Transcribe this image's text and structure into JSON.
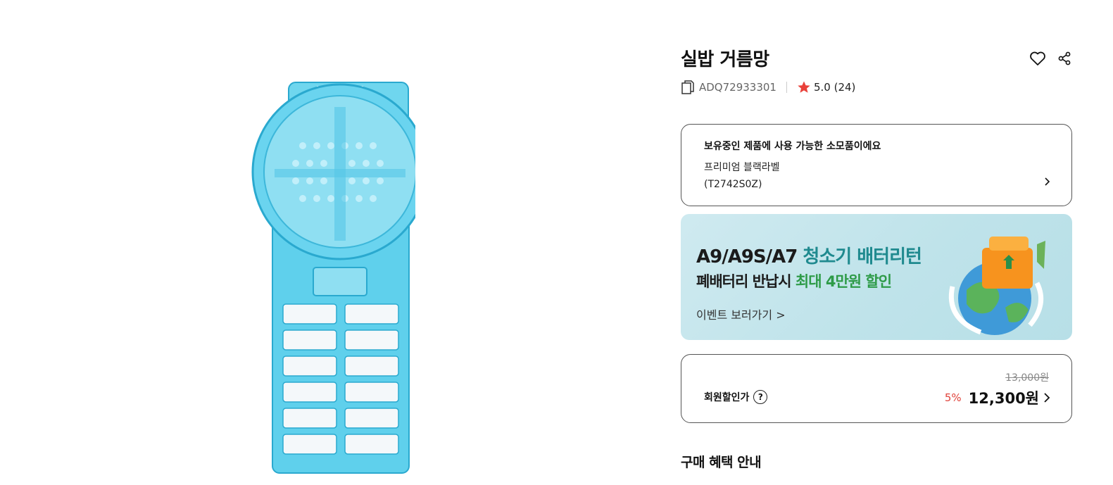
{
  "product": {
    "title": "실밥 거름망",
    "code": "ADQ72933301",
    "rating": "5.0 (24)",
    "image_icon": "lint-filter-product-image"
  },
  "actions": {
    "wishlist_icon": "heart-icon",
    "share_icon": "share-icon"
  },
  "compat": {
    "heading": "보유중인 제품에 사용 가능한 소모품이에요",
    "model_name": "프리미엄 블랙라벨",
    "model_code": "(T2742S0Z)"
  },
  "banner": {
    "line1_a": "A9/A9S/A7 ",
    "line1_b": "청소기 배터리턴",
    "line2_a": "폐배터리 반납시 ",
    "line2_b": "최대 4만원 할인",
    "link": "이벤트 보러가기 >",
    "colors": {
      "accent1": "#1f8a8f",
      "accent2": "#2e9b48"
    }
  },
  "price": {
    "original": "13,000원",
    "member_label": "회원할인가",
    "help": "?",
    "discount": "5%",
    "sale": "12,300원"
  },
  "section": {
    "benefits_title": "구매 혜택 안내"
  },
  "colors": {
    "discount": "#e0433b",
    "star": "#e9413a"
  }
}
